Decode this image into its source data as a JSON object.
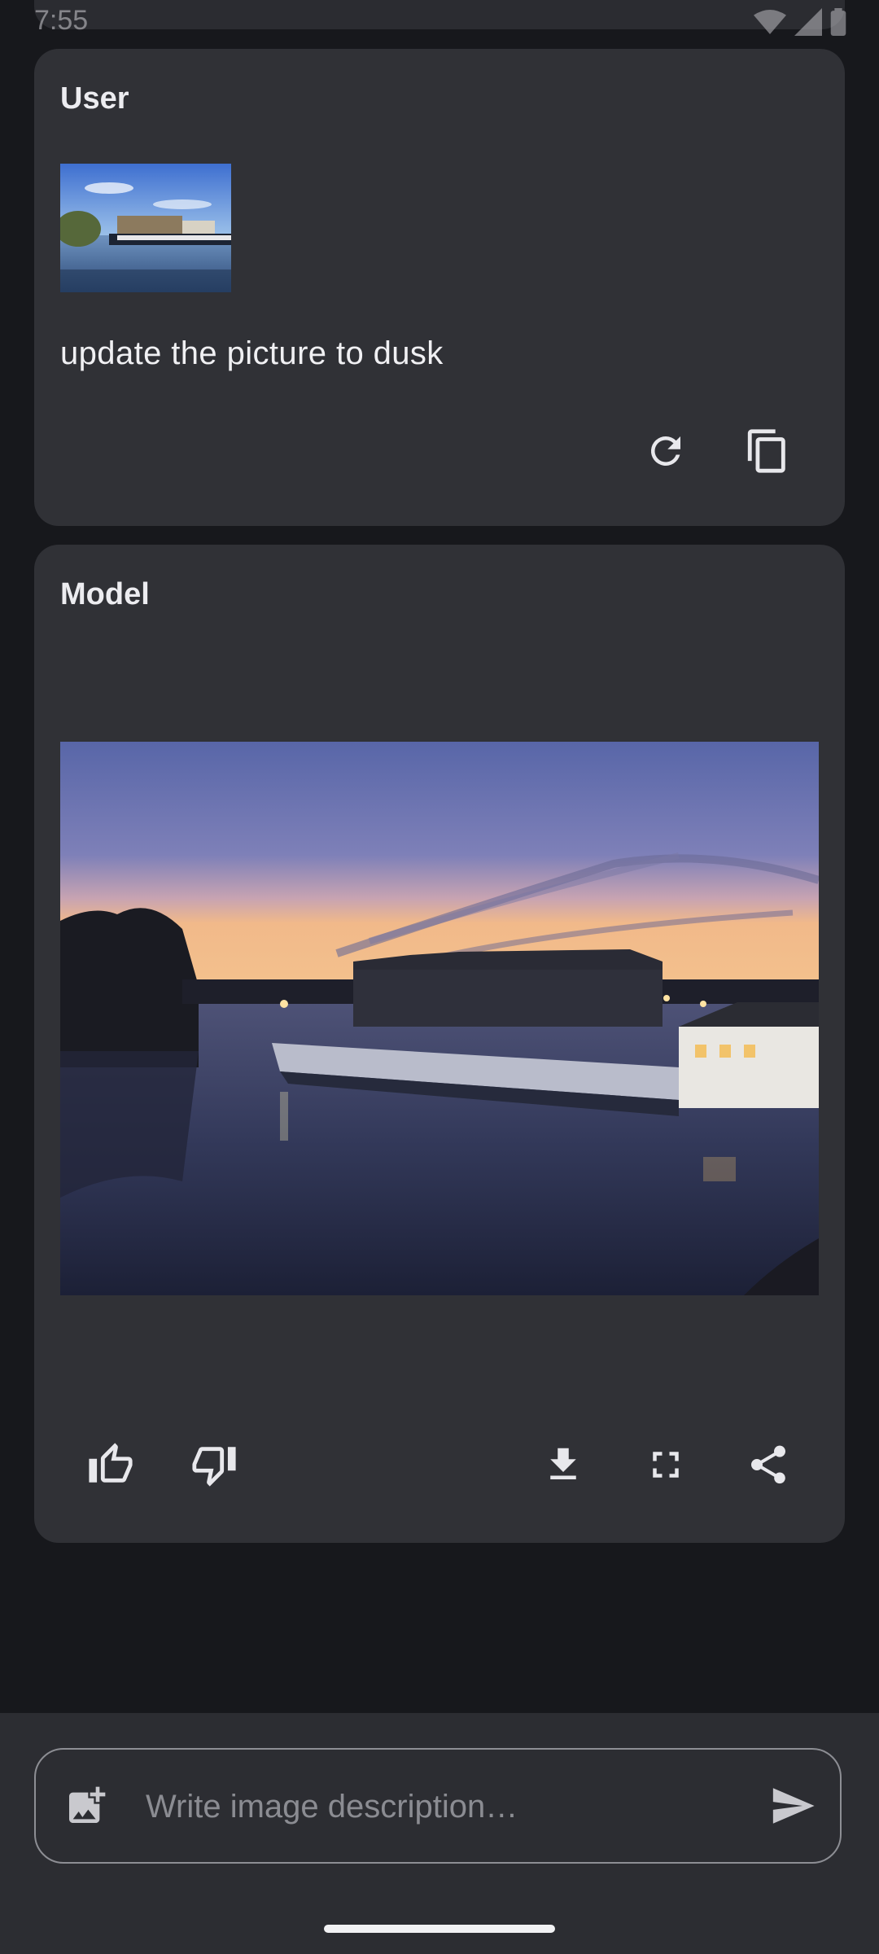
{
  "status_bar": {
    "time": "7:55"
  },
  "user_card": {
    "title": "User",
    "prompt": "update the picture to dusk",
    "actions": [
      "refresh-icon",
      "copy-icon"
    ]
  },
  "model_card": {
    "title": "Model",
    "actions": [
      "thumb-up-icon",
      "thumb-down-icon",
      "download-icon",
      "fullscreen-icon",
      "share-icon"
    ]
  },
  "composer": {
    "placeholder": "Write image description…",
    "icons": [
      "add-photo-icon",
      "send-icon"
    ]
  },
  "colors": {
    "background": "#17181c",
    "card": "#303136",
    "bottom_bar": "#2c2d32",
    "text": "#ececf0",
    "placeholder": "#8b8c92"
  }
}
